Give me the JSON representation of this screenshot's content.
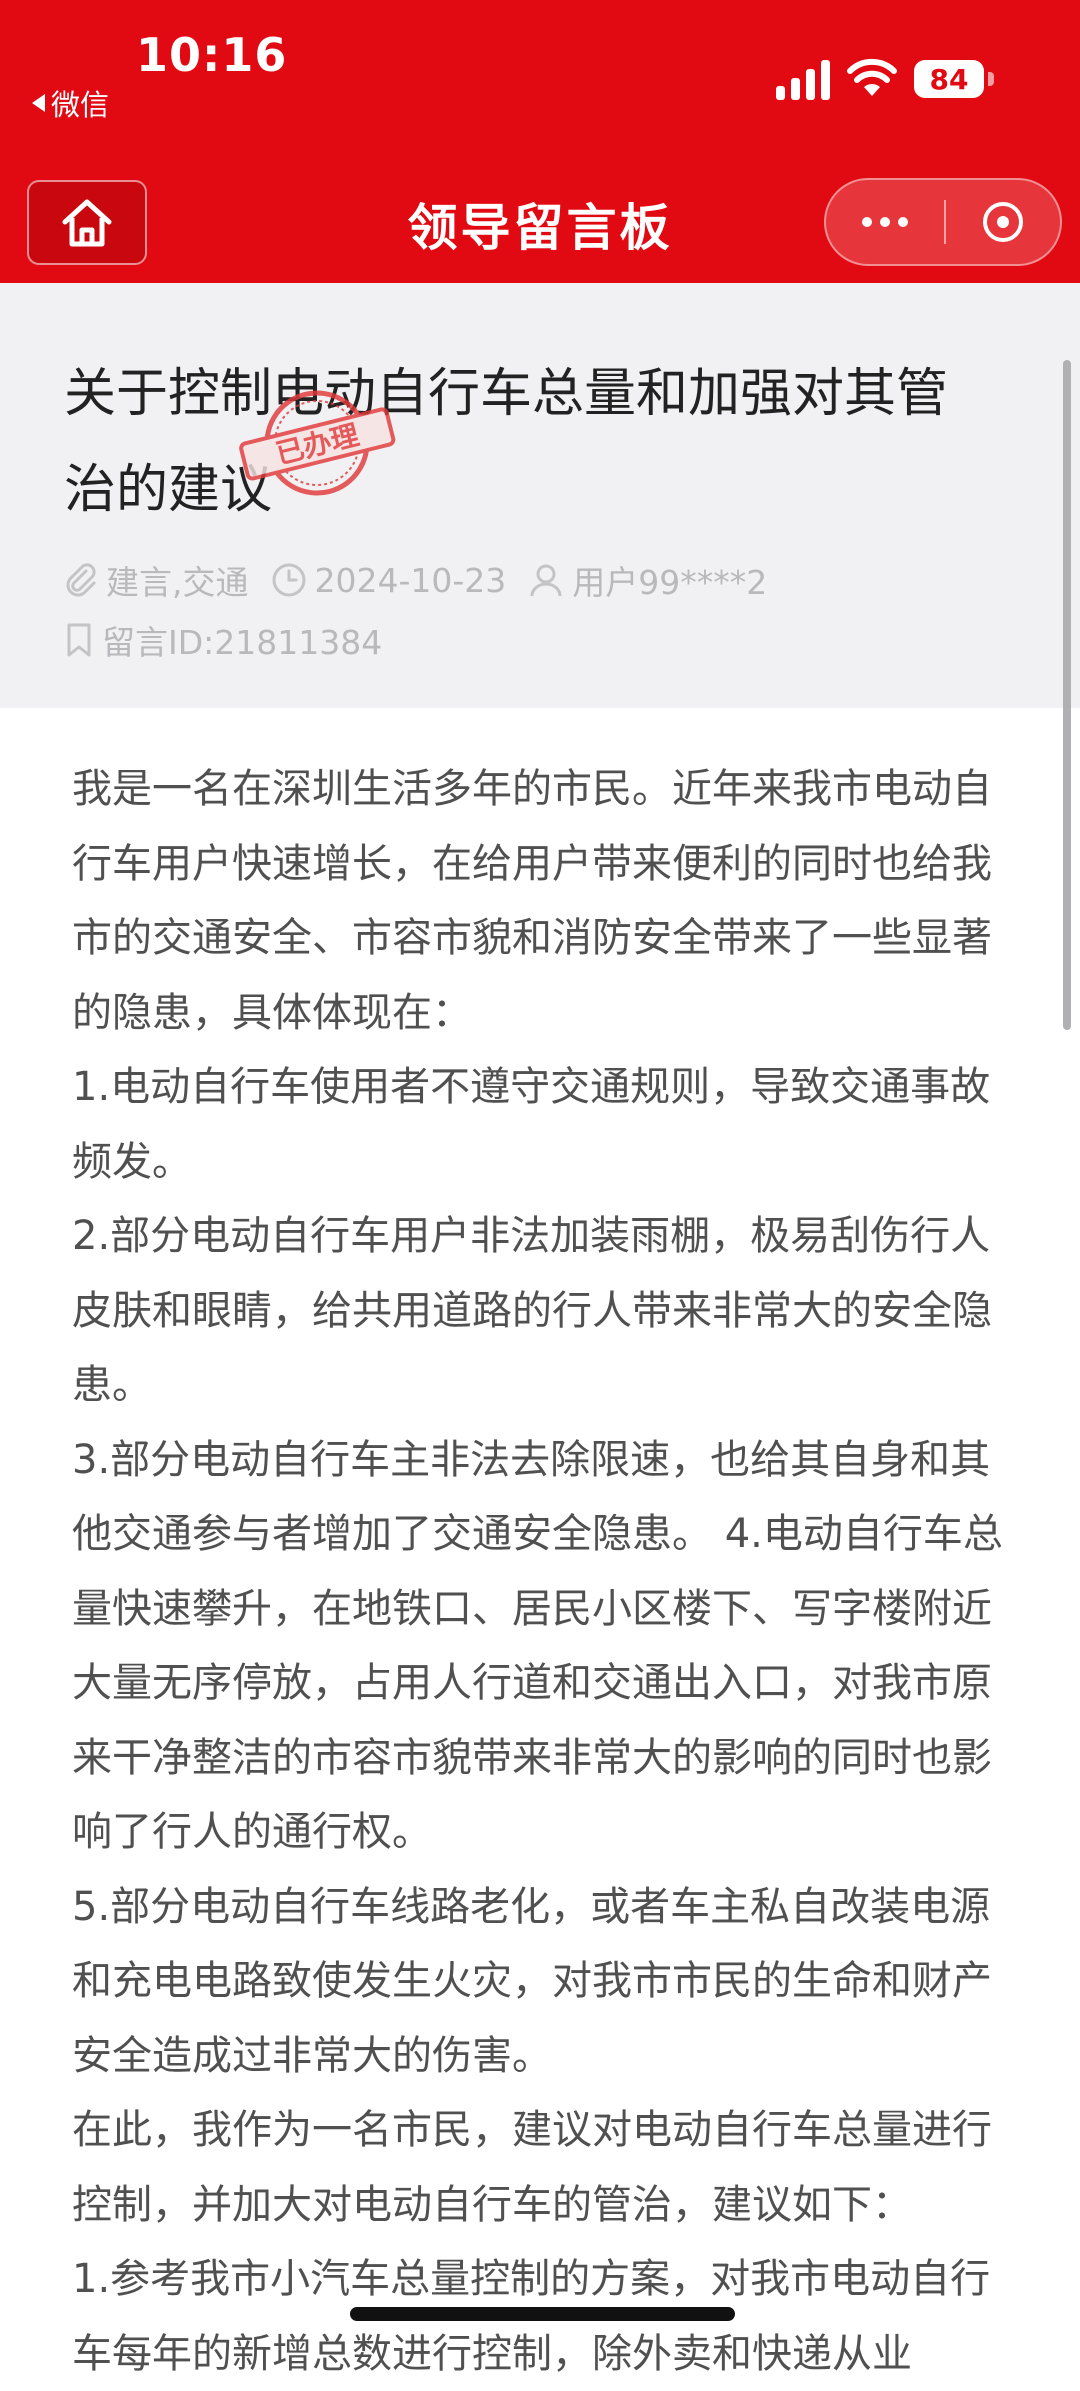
{
  "status_bar": {
    "time": "10:16",
    "back_app": "微信",
    "battery": "84"
  },
  "nav": {
    "title": "领导留言板",
    "home_icon": "home-icon",
    "more_icon": "more-dots-icon",
    "close_icon": "target-circle-icon"
  },
  "message": {
    "title": "关于控制电动自行车总量和加强对其管治的建议",
    "stamp": "已办理",
    "tags": "建言,交通",
    "date": "2024-10-23",
    "user": "用户99****2",
    "message_id": "留言ID:21811384"
  },
  "body": [
    "我是一名在深圳生活多年的市民。近年来我市电动自行车用户快速增长，在给用户带来便利的同时也给我市的交通安全、市容市貌和消防安全带来了一些显著的隐患，具体体现在：",
    "1.电动自行车使用者不遵守交通规则，导致交通事故频发。",
    "2.部分电动自行车用户非法加装雨棚，极易刮伤行人皮肤和眼睛，给共用道路的行人带来非常大的安全隐患。",
    "3.部分电动自行车主非法去除限速，也给其自身和其他交通参与者增加了交通安全隐患。 4.电动自行车总量快速攀升，在地铁口、居民小区楼下、写字楼附近大量无序停放，占用人行道和交通出入口，对我市原来干净整洁的市容市貌带来非常大的影响的同时也影响了行人的通行权。",
    "5.部分电动自行车线路老化，或者车主私自改装电源和充电电路致使发生火灾，对我市市民的生命和财产安全造成过非常大的伤害。",
    "在此，我作为一名市民，建议对电动自行车总量进行控制，并加大对电动自行车的管治，建议如下：",
    "1.参考我市小汽车总量控制的方案，对我市电动自行车每年的新增总数进行控制，除外卖和快递从业"
  ],
  "colors": {
    "brand_red": "#e10a12",
    "stamp_red": "#e23a3a",
    "meta_gray": "#b9b9bd",
    "body_text": "#505050"
  }
}
